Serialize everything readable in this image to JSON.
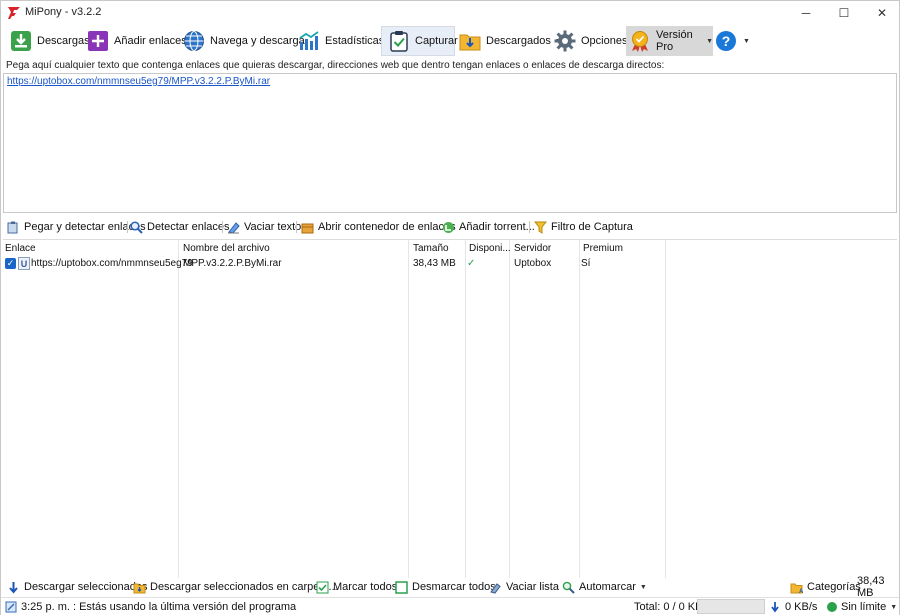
{
  "window": {
    "title": "MiPony - v3.2.2",
    "controls": {
      "minimize": "─",
      "maximize": "☐",
      "close": "✕"
    }
  },
  "toolbar": {
    "items": [
      {
        "label": "Descargas",
        "icon": "download-arrow-icon"
      },
      {
        "label": "Añadir enlaces",
        "icon": "plus-icon"
      },
      {
        "label": "Navega y descarga",
        "icon": "globe-icon"
      },
      {
        "label": "Estadísticas",
        "icon": "chart-icon"
      },
      {
        "label": "Capturar",
        "icon": "clipboard-check-icon"
      },
      {
        "label": "Descargados",
        "icon": "folder-download-icon"
      },
      {
        "label": "Opciones",
        "icon": "gear-icon"
      },
      {
        "label": "Versión Pro",
        "icon": "medal-icon"
      }
    ],
    "help_label": "?"
  },
  "paste": {
    "hint": "Pega aquí cualquier texto que contenga enlaces que quieras descargar, direcciones web que dentro tengan enlaces o enlaces de descarga directos:",
    "content": "https://uptobox.com/nmmnseu5eg79/MPP.v3.2.2.P.ByMi.rar"
  },
  "actions": [
    {
      "label": "Pegar y detectar enlaces",
      "icon": "paste-icon"
    },
    {
      "label": "Detectar enlaces",
      "icon": "magnifier-icon"
    },
    {
      "label": "Vaciar texto",
      "icon": "eraser-icon"
    },
    {
      "label": "Abrir contenedor de enlaces",
      "icon": "box-icon"
    },
    {
      "label": "Añadir torrent...",
      "icon": "torrent-icon"
    },
    {
      "label": "Filtro de Captura",
      "icon": "filter-icon"
    }
  ],
  "table": {
    "columns": [
      "Enlace",
      "Nombre del archivo",
      "Tamaño",
      "Disponi...",
      "Servidor",
      "Premium"
    ],
    "rows": [
      {
        "link": "https://uptobox.com/nmmnseu5eg79",
        "filename": "MPP.v3.2.2.P.ByMi.rar",
        "size": "38,43 MB",
        "available": "✓",
        "server": "Uptobox",
        "premium": "Sí"
      }
    ]
  },
  "bottom_actions": [
    {
      "label": "Descargar seleccionados",
      "icon": "arrow-down-icon"
    },
    {
      "label": "Descargar seleccionados en carpeta...",
      "icon": "folder-icon"
    },
    {
      "label": "Marcar todos",
      "icon": "check-all-icon"
    },
    {
      "label": "Desmarcar todos",
      "icon": "uncheck-all-icon"
    },
    {
      "label": "Vaciar lista",
      "icon": "clear-list-icon"
    },
    {
      "label": "Automarcar",
      "icon": "auto-mark-icon"
    }
  ],
  "categories": {
    "label": "Categorías",
    "size": "38,43 MB"
  },
  "status": {
    "message": "3:25 p. m. : Estás usando la última versión del programa",
    "total": "Total: 0 / 0 KB",
    "progress": 0,
    "speed": "0 KB/s",
    "limit": "Sin límite"
  },
  "colors": {
    "accent": "#1a66c8",
    "link": "#1a55c8",
    "selected_tab": "#e8eef8"
  }
}
